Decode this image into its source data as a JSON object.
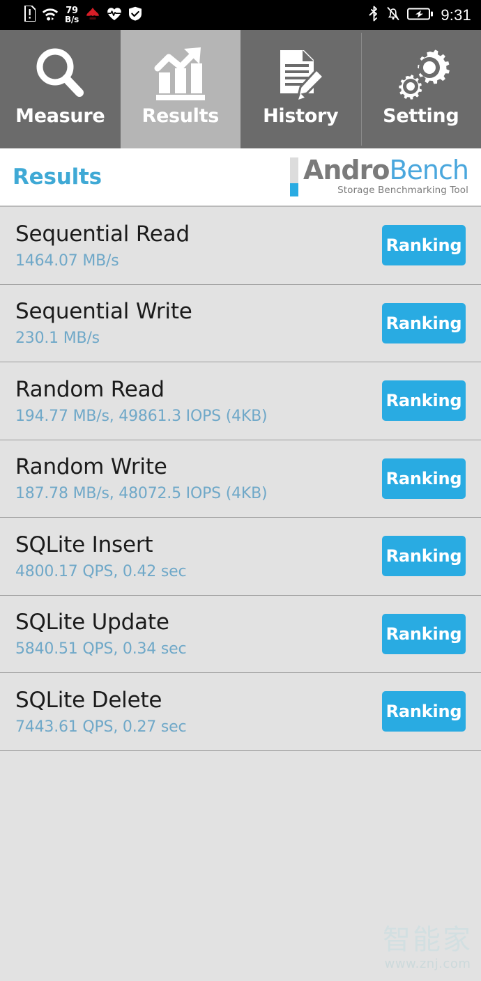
{
  "status_bar": {
    "icons_left": [
      "sim-card-alert-icon",
      "wifi-icon",
      "huawei-logo-icon",
      "heart-rate-icon",
      "security-shield-icon"
    ],
    "network_speed_value": "79",
    "network_speed_unit": "B/s",
    "icons_right": [
      "bluetooth-icon",
      "mute-bell-icon",
      "battery-charging-icon"
    ],
    "clock": "9:31"
  },
  "tabs": [
    {
      "label": "Measure",
      "icon": "magnifier-icon",
      "active": false
    },
    {
      "label": "Results",
      "icon": "bar-chart-arrow-icon",
      "active": true
    },
    {
      "label": "History",
      "icon": "document-pencil-icon",
      "active": false
    },
    {
      "label": "Setting",
      "icon": "gears-icon",
      "active": false
    }
  ],
  "header": {
    "title": "Results",
    "logo_main_primary": "Andro",
    "logo_main_secondary": "Bench",
    "logo_tagline": "Storage Benchmarking Tool"
  },
  "results": {
    "button_label": "Ranking",
    "rows": [
      {
        "title": "Sequential Read",
        "value": "1464.07 MB/s"
      },
      {
        "title": "Sequential Write",
        "value": "230.1 MB/s"
      },
      {
        "title": "Random Read",
        "value": "194.77 MB/s, 49861.3 IOPS (4KB)"
      },
      {
        "title": "Random Write",
        "value": "187.78 MB/s, 48072.5 IOPS (4KB)"
      },
      {
        "title": "SQLite Insert",
        "value": "4800.17 QPS, 0.42 sec"
      },
      {
        "title": "SQLite Update",
        "value": "5840.51 QPS, 0.34 sec"
      },
      {
        "title": "SQLite Delete",
        "value": "7443.61 QPS, 0.27 sec"
      }
    ]
  },
  "watermark": {
    "text_cn": "智能家",
    "url": "www.znj.com"
  },
  "colors": {
    "accent_blue": "#29abe2",
    "title_blue": "#3fa9d5",
    "value_blue": "#6fa8c8",
    "tab_inactive": "#6b6b6b",
    "tab_active": "#b5b5b5",
    "list_background": "#e2e2e2"
  }
}
